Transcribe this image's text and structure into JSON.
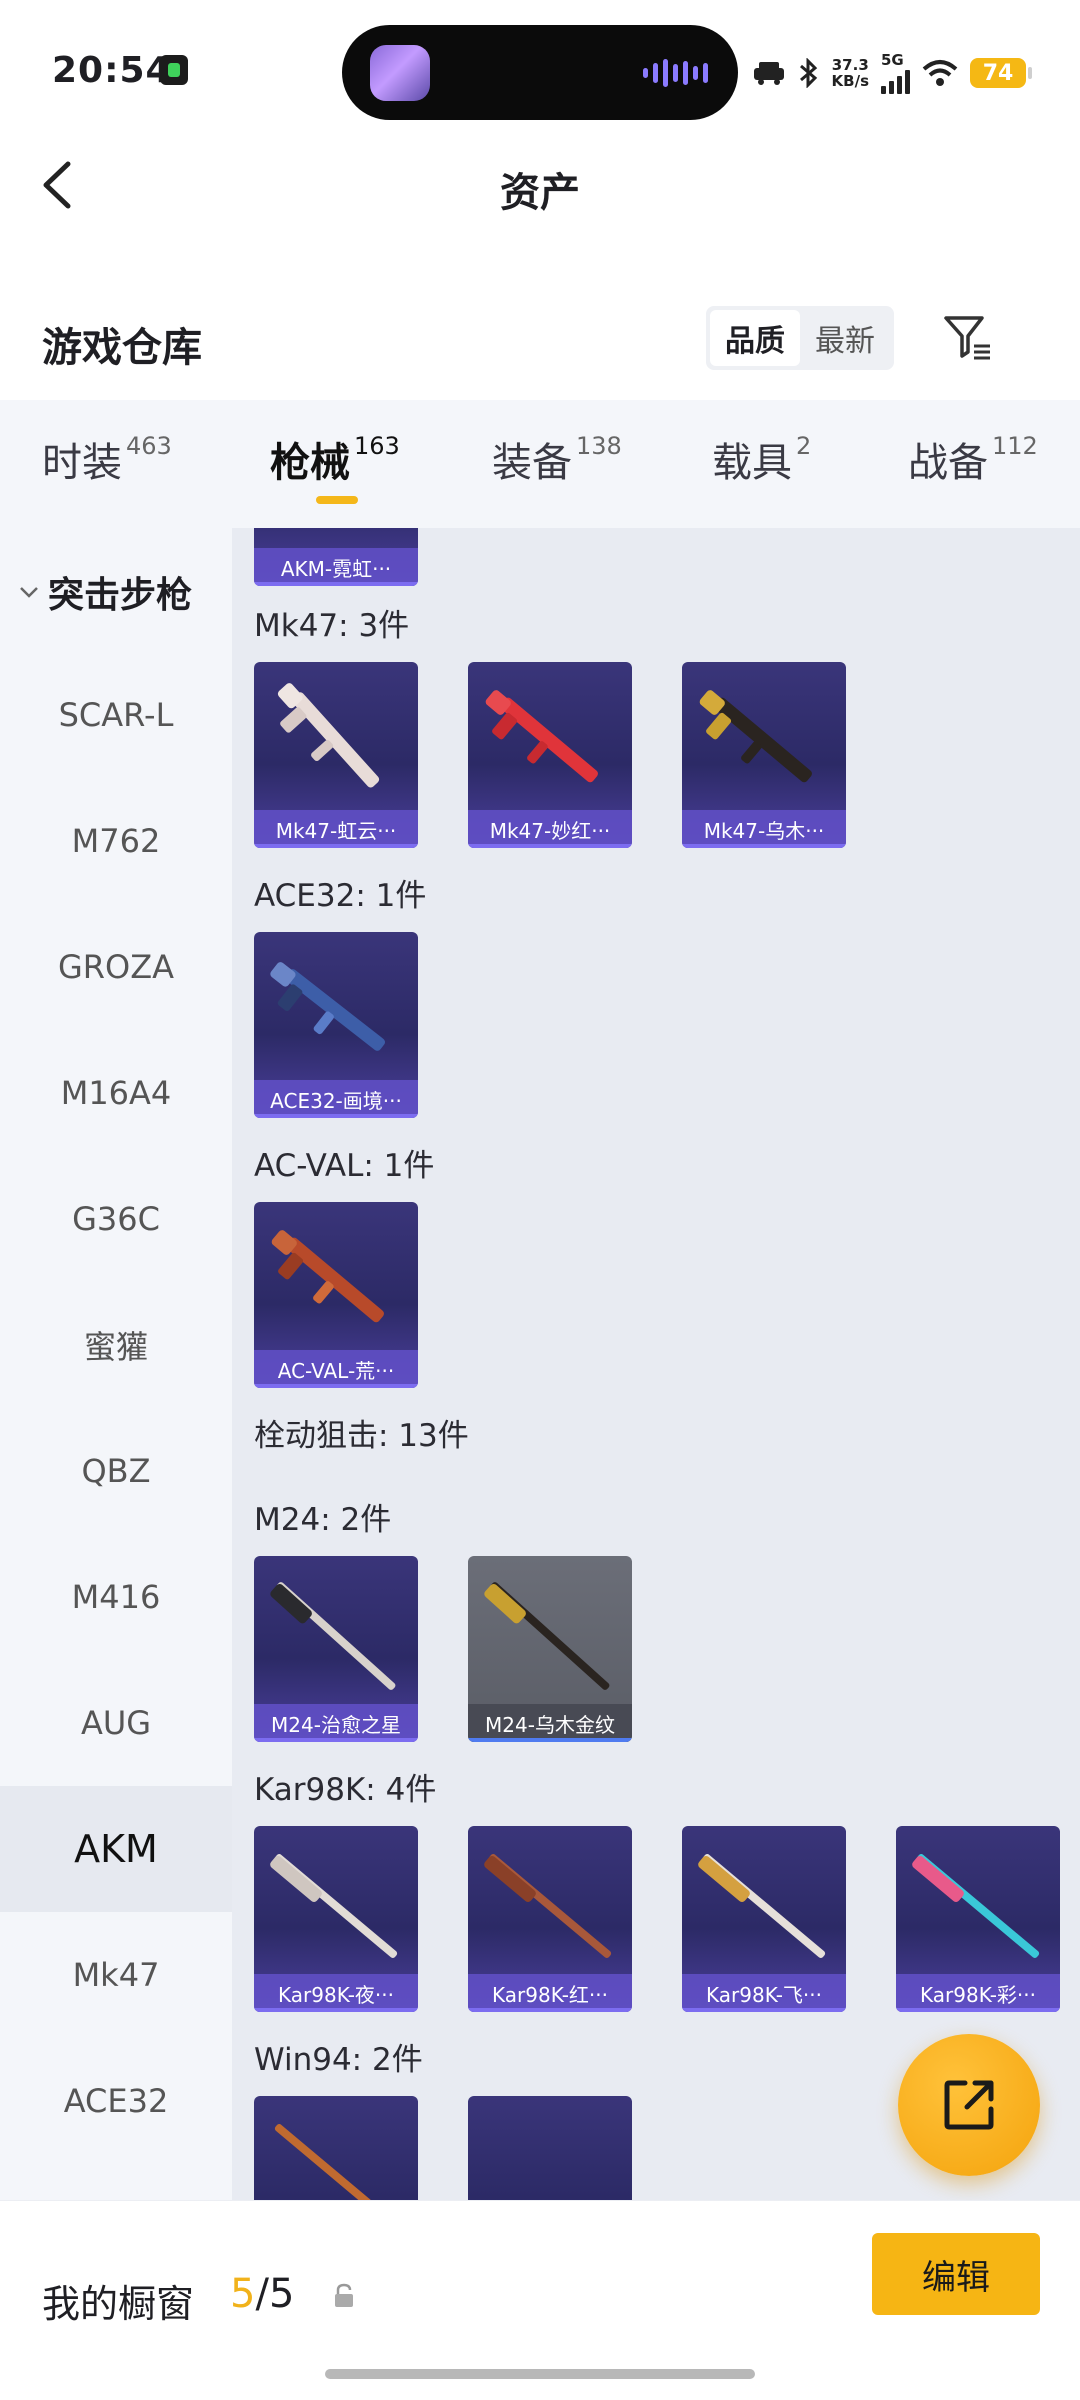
{
  "status_bar": {
    "time": "20:54",
    "net_speed_value": "37.3",
    "net_speed_unit": "KB/s",
    "network": "5G",
    "battery": "74"
  },
  "nav": {
    "title": "资产",
    "back_icon": "chevron-left-icon"
  },
  "warehouse": {
    "title": "游戏仓库",
    "sort_options": [
      "品质",
      "最新"
    ],
    "sort_selected": "品质",
    "filter_icon": "filter-icon"
  },
  "tabs": [
    {
      "label": "时装",
      "count": "463"
    },
    {
      "label": "枪械",
      "count": "163",
      "active": true
    },
    {
      "label": "装备",
      "count": "138"
    },
    {
      "label": "载具",
      "count": "2"
    },
    {
      "label": "战备",
      "count": "112"
    }
  ],
  "sidebar": {
    "category": "突击步枪",
    "items": [
      "SCAR-L",
      "M762",
      "GROZA",
      "M16A4",
      "G36C",
      "蜜獾",
      "QBZ",
      "M416",
      "AUG",
      "AKM",
      "Mk47",
      "ACE32"
    ],
    "active": "AKM"
  },
  "content": {
    "partial_top_card": "AKM-霓虹···",
    "sections": {
      "mk47": {
        "label": "Mk47: 3件",
        "cards": [
          "Mk47-虹云···",
          "Mk47-妙红···",
          "Mk47-乌木···"
        ]
      },
      "ace32": {
        "label": "ACE32: 1件",
        "cards": [
          "ACE32-画境···"
        ]
      },
      "acval": {
        "label": "AC-VAL: 1件",
        "cards": [
          "AC-VAL-荒···"
        ]
      },
      "bolt": {
        "label": "栓动狙击: 13件"
      },
      "m24": {
        "label": "M24: 2件",
        "cards": [
          "M24-治愈之星",
          "M24-乌木金纹"
        ]
      },
      "kar98k": {
        "label": "Kar98K: 4件",
        "cards": [
          "Kar98K-夜···",
          "Kar98K-红···",
          "Kar98K-飞···",
          "Kar98K-彩···"
        ]
      },
      "win94": {
        "label": "Win94: 2件"
      }
    }
  },
  "fab": {
    "icon": "share-icon"
  },
  "bottom": {
    "my_window": "我的橱窗",
    "count_current": "5",
    "count_sep": "/",
    "count_total": "5",
    "lock_icon": "lock-icon",
    "edit": "编辑"
  }
}
